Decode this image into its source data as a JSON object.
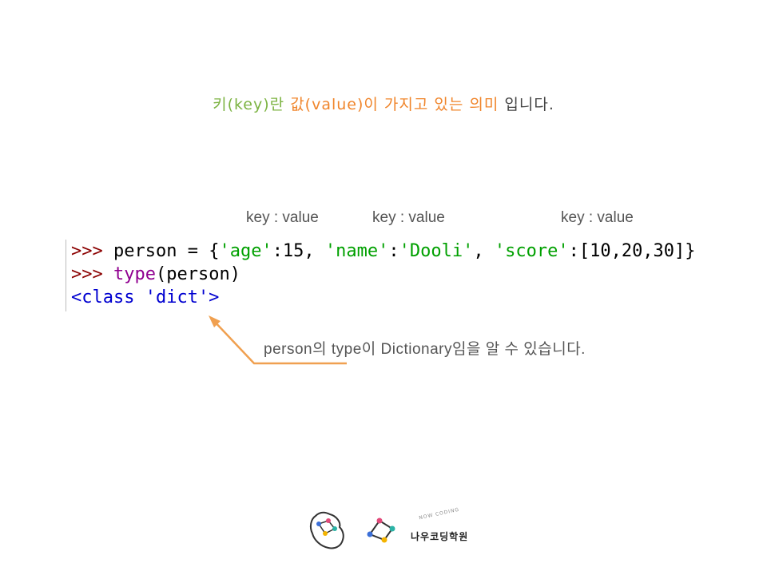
{
  "headline": {
    "key_part": "키(key)란",
    "value_part": "값(value)이 가지고 있는 의미",
    "tail": " 입니다."
  },
  "kv_labels": [
    "key : value",
    "key : value",
    "key : value"
  ],
  "code": {
    "line1": {
      "prompt": ">>>",
      "segments": [
        {
          "t": " person = {",
          "c": ""
        },
        {
          "t": "'age'",
          "c": "str"
        },
        {
          "t": ":15, ",
          "c": ""
        },
        {
          "t": "'name'",
          "c": "str"
        },
        {
          "t": ":",
          "c": ""
        },
        {
          "t": "'Dooli'",
          "c": "str"
        },
        {
          "t": ", ",
          "c": ""
        },
        {
          "t": "'score'",
          "c": "str"
        },
        {
          "t": ":[10,20,30]}",
          "c": ""
        }
      ]
    },
    "line2": {
      "prompt": ">>>",
      "builtin": "type",
      "rest": "(person)"
    },
    "line3": {
      "output": "<class 'dict'>"
    }
  },
  "note": "person의 type이 Dictionary임을 알 수 있습니다.",
  "logo": {
    "name": "나우코딩학원",
    "sub": "NOW CODING"
  },
  "colors": {
    "key": "#7cb342",
    "value": "#f0852b",
    "arrow": "#f0a050"
  }
}
